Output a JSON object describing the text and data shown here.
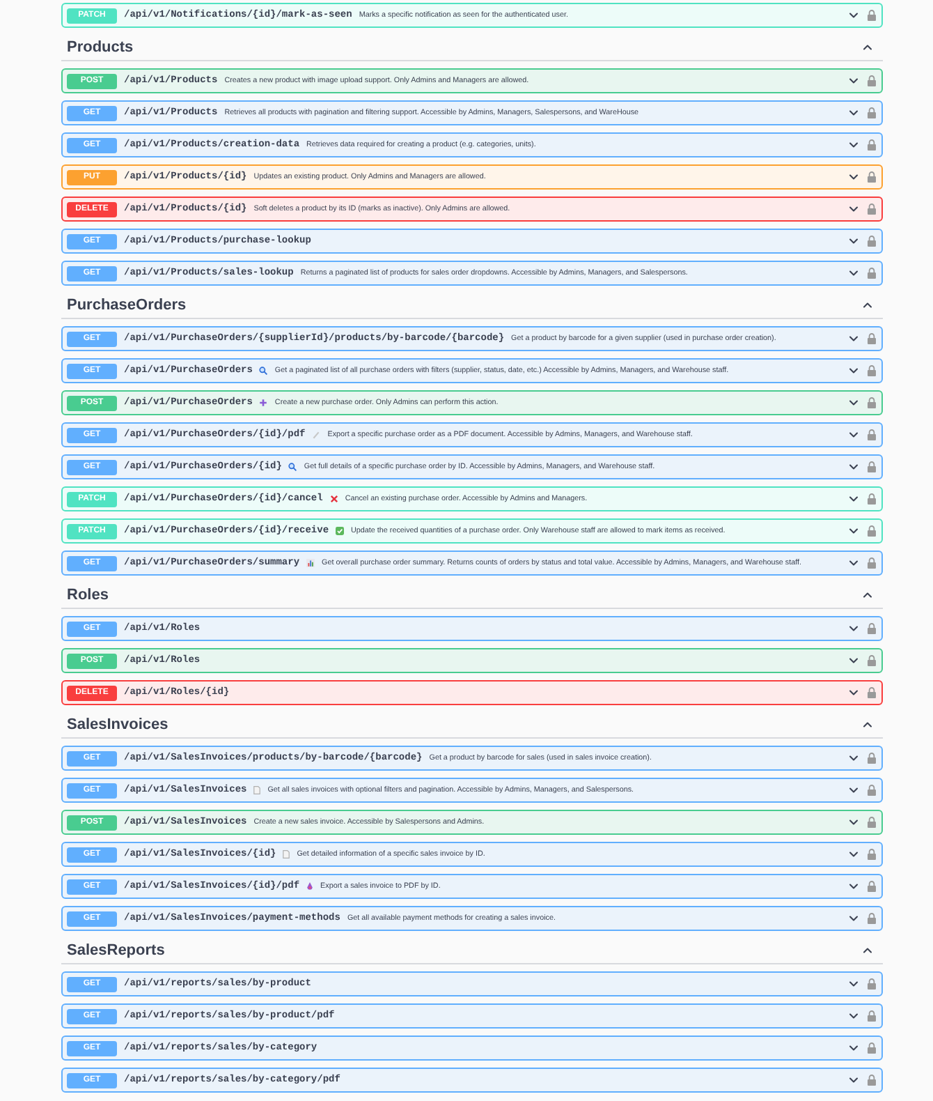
{
  "sections": [
    {
      "endpoints": [
        {
          "method": "PATCH",
          "path": "/api/v1/Notifications/{id}/mark-as-seen",
          "description": "Marks a specific notification as seen for the authenticated user."
        }
      ]
    },
    {
      "title": "Products",
      "expanded": true,
      "endpoints": [
        {
          "method": "POST",
          "path": "/api/v1/Products",
          "description": "Creates a new product with image upload support. Only Admins and Managers are allowed."
        },
        {
          "method": "GET",
          "path": "/api/v1/Products",
          "description": "Retrieves all products with pagination and filtering support. Accessible by Admins, Managers, Salespersons, and WareHouse"
        },
        {
          "method": "GET",
          "path": "/api/v1/Products/creation-data",
          "description": "Retrieves data required for creating a product (e.g. categories, units)."
        },
        {
          "method": "PUT",
          "path": "/api/v1/Products/{id}",
          "description": "Updates an existing product. Only Admins and Managers are allowed."
        },
        {
          "method": "DELETE",
          "path": "/api/v1/Products/{id}",
          "description": "Soft deletes a product by its ID (marks as inactive). Only Admins are allowed."
        },
        {
          "method": "GET",
          "path": "/api/v1/Products/purchase-lookup"
        },
        {
          "method": "GET",
          "path": "/api/v1/Products/sales-lookup",
          "description": "Returns a paginated list of products for sales order dropdowns. Accessible by Admins, Managers, and Salespersons."
        }
      ]
    },
    {
      "title": "PurchaseOrders",
      "expanded": true,
      "endpoints": [
        {
          "method": "GET",
          "path": "/api/v1/PurchaseOrders/{supplierId}/products/by-barcode/{barcode}",
          "description": "Get a product by barcode for a given supplier (used in purchase order creation)."
        },
        {
          "method": "GET",
          "path": "/api/v1/PurchaseOrders",
          "kind": "magnifier",
          "description": "Get a paginated list of all purchase orders with filters (supplier, status, date, etc.) Accessible by Admins, Managers, and Warehouse staff."
        },
        {
          "method": "POST",
          "path": "/api/v1/PurchaseOrders",
          "kind": "plus",
          "description": "Create a new purchase order. Only Admins can perform this action."
        },
        {
          "method": "GET",
          "path": "/api/v1/PurchaseOrders/{id}/pdf",
          "kind": "pencil",
          "description": "Export a specific purchase order as a PDF document. Accessible by Admins, Managers, and Warehouse staff."
        },
        {
          "method": "GET",
          "path": "/api/v1/PurchaseOrders/{id}",
          "kind": "magnifier",
          "description": "Get full details of a specific purchase order by ID. Accessible by Admins, Managers, and Warehouse staff."
        },
        {
          "method": "PATCH",
          "path": "/api/v1/PurchaseOrders/{id}/cancel",
          "kind": "cross",
          "description": "Cancel an existing purchase order. Accessible by Admins and Managers."
        },
        {
          "method": "PATCH",
          "path": "/api/v1/PurchaseOrders/{id}/receive",
          "kind": "check",
          "description": "Update the received quantities of a purchase order. Only Warehouse staff are allowed to mark items as received."
        },
        {
          "method": "GET",
          "path": "/api/v1/PurchaseOrders/summary",
          "kind": "chart",
          "description": "Get overall purchase order summary. Returns counts of orders by status and total value. Accessible by Admins, Managers, and Warehouse staff."
        }
      ]
    },
    {
      "title": "Roles",
      "expanded": true,
      "endpoints": [
        {
          "method": "GET",
          "path": "/api/v1/Roles"
        },
        {
          "method": "POST",
          "path": "/api/v1/Roles"
        },
        {
          "method": "DELETE",
          "path": "/api/v1/Roles/{id}"
        }
      ]
    },
    {
      "title": "SalesInvoices",
      "expanded": true,
      "endpoints": [
        {
          "method": "GET",
          "path": "/api/v1/SalesInvoices/products/by-barcode/{barcode}",
          "description": "Get a product by barcode for sales (used in sales invoice creation)."
        },
        {
          "method": "GET",
          "path": "/api/v1/SalesInvoices",
          "kind": "document",
          "description": "Get all sales invoices with optional filters and pagination. Accessible by Admins, Managers, and Salespersons."
        },
        {
          "method": "POST",
          "path": "/api/v1/SalesInvoices",
          "description": "Create a new sales invoice. Accessible by Salespersons and Admins."
        },
        {
          "method": "GET",
          "path": "/api/v1/SalesInvoices/{id}",
          "kind": "document",
          "description": "Get detailed information of a specific sales invoice by ID."
        },
        {
          "method": "GET",
          "path": "/api/v1/SalesInvoices/{id}/pdf",
          "kind": "drop",
          "description": "Export a sales invoice to PDF by ID."
        },
        {
          "method": "GET",
          "path": "/api/v1/SalesInvoices/payment-methods",
          "description": "Get all available payment methods for creating a sales invoice."
        }
      ]
    },
    {
      "title": "SalesReports",
      "expanded": true,
      "endpoints": [
        {
          "method": "GET",
          "path": "/api/v1/reports/sales/by-product"
        },
        {
          "method": "GET",
          "path": "/api/v1/reports/sales/by-product/pdf"
        },
        {
          "method": "GET",
          "path": "/api/v1/reports/sales/by-category"
        },
        {
          "method": "GET",
          "path": "/api/v1/reports/sales/by-category/pdf"
        }
      ]
    }
  ]
}
